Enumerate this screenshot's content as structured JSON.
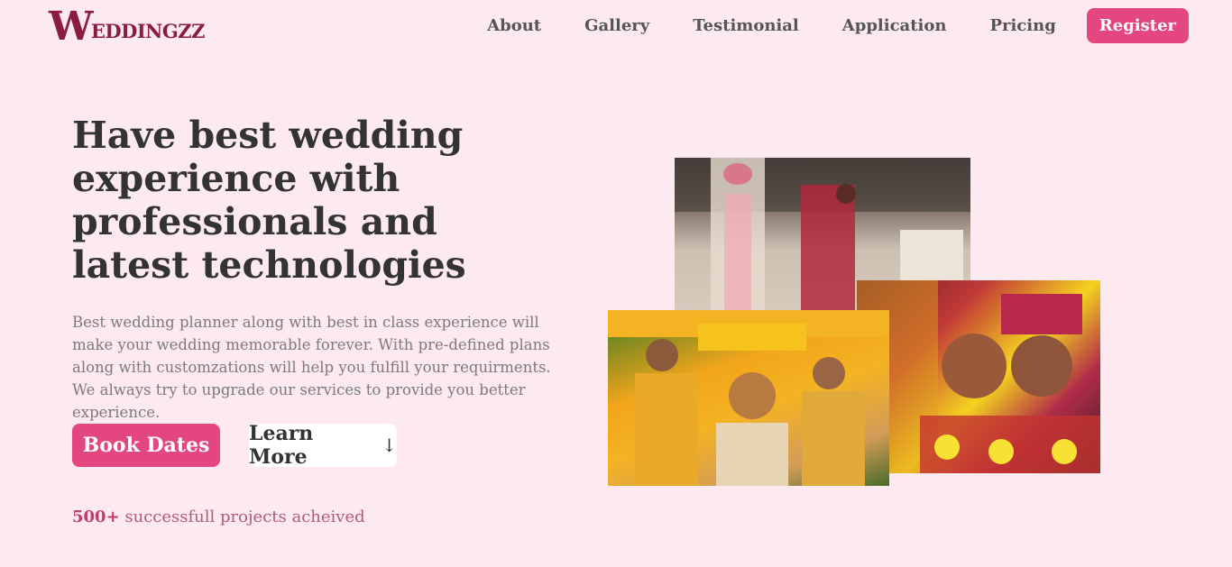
{
  "brand": {
    "logo_initial": "W",
    "logo_rest": "EDDINGZZ",
    "color": "#8a1c3f"
  },
  "nav": {
    "items": [
      "About",
      "Gallery",
      "Testimonial",
      "Application",
      "Pricing"
    ],
    "register_label": "Register"
  },
  "hero": {
    "headline": "Have best wedding experience with professionals and latest technologies",
    "description": "Best wedding planner along with best in class experience will make your wedding memorable forever. With pre-defined plans along with customzations will help you fulfill your requirments. We always try to upgrade our services to provide you better experience.",
    "book_button": "Book Dates",
    "learn_button": "Learn More",
    "learn_icon": "arrow-down-icon",
    "stats_count": "500+",
    "stats_text": "successfull projects acheived"
  },
  "gallery": {
    "photos": [
      "wedding-ceremony-photo",
      "haldi-ceremony-photo",
      "couple-portrait-photo"
    ]
  },
  "colors": {
    "accent": "#e4467f",
    "background": "#fdeaf0",
    "heading": "#333333"
  }
}
